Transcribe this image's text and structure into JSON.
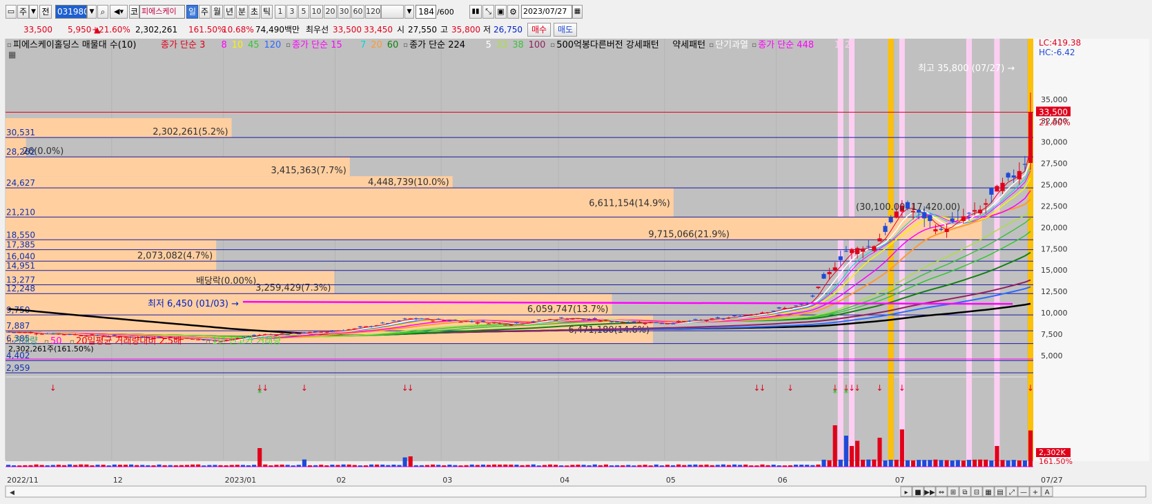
{
  "toolbar": {
    "period_select": "주",
    "adj_select": "전",
    "stock_code": "031980",
    "market_tag": "코",
    "stock_name": "피에스케이",
    "periods": [
      "일",
      "주",
      "월",
      "년",
      "분",
      "초",
      "틱"
    ],
    "active_period": "일",
    "minute_options": [
      "1",
      "3",
      "5",
      "10",
      "20",
      "30",
      "60",
      "120"
    ],
    "count": "184",
    "count_total": "/600",
    "date": "2023/07/27"
  },
  "quote": {
    "price": "33,500",
    "change": "5,950 ▲",
    "change_pct": "+21.60%",
    "volume": "2,302,261",
    "vol_ratio": "161.50%",
    "turnover": "10.68%",
    "amount": "74,490백만",
    "ask_label": "최우선",
    "ask_price": "33,500",
    "bid_price": "33,450",
    "open_label": "시",
    "open": "27,550",
    "high_label": "고",
    "high": "35,800",
    "low_label": "저",
    "low": "26,750",
    "buy_label": "매수",
    "sell_label": "매도"
  },
  "colors": {
    "up": "#e0001a",
    "down": "#1f49d8",
    "panel": "#c0c0c0",
    "vp": "#ffcfa0",
    "bg": "#f0f0f0"
  },
  "chart_data": [
    {
      "type": "candlestick",
      "legend": [
        {
          "text": "피에스케이홀딩스 매물대 수(10)",
          "color": "#000000"
        },
        {
          "text": "종가 단순 3",
          "color": "#e0001a"
        },
        {
          "text": "8",
          "color": "#ff00ff"
        },
        {
          "text": "10",
          "color": "#f5f500"
        },
        {
          "text": "45",
          "color": "#30c830"
        },
        {
          "text": "120",
          "color": "#2a6aff"
        },
        {
          "text": "종가 단순 15",
          "color": "#ff00ff"
        },
        {
          "text": "7",
          "color": "#00d8d8"
        },
        {
          "text": "20",
          "color": "#ff9a30"
        },
        {
          "text": "60",
          "color": "#108010"
        },
        {
          "text": "종가 단순 224",
          "color": "#000000"
        },
        {
          "text": "5",
          "color": "#ffffff"
        },
        {
          "text": "33",
          "color": "#a8e040"
        },
        {
          "text": "38",
          "color": "#40c040"
        },
        {
          "text": "100",
          "color": "#902060"
        },
        {
          "text": "500억봉다른버전 강세패턴",
          "color": "#000000"
        },
        {
          "text": "약세패턴",
          "color": "#000000"
        },
        {
          "text": "단기과열",
          "color": "#ffffff"
        },
        {
          "text": "종가 단순 448",
          "color": "#ff00ff"
        },
        {
          "text": "1",
          "color": "#ffd0f0"
        },
        {
          "text": "2",
          "color": "#ffd0f0"
        }
      ],
      "ylim": [
        2800,
        37500
      ],
      "price_ticks": [
        35000,
        32500,
        30000,
        27500,
        25000,
        22500,
        20000,
        17500,
        15000,
        12500,
        10000,
        7500,
        5000
      ],
      "price_tick_labels": [
        "35,000",
        "32,500",
        "30,000",
        "27,500",
        "25,000",
        "22,500",
        "20,000",
        "17,500",
        "15,000",
        "12,500",
        "10,000",
        "7,500",
        "5,000"
      ],
      "x_ticks": [
        {
          "i": 0,
          "label": "2022/11"
        },
        {
          "i": 19,
          "label": "12"
        },
        {
          "i": 39,
          "label": "2023/01"
        },
        {
          "i": 59,
          "label": "02"
        },
        {
          "i": 78,
          "label": "03"
        },
        {
          "i": 99,
          "label": "04"
        },
        {
          "i": 118,
          "label": "05"
        },
        {
          "i": 138,
          "label": "06"
        },
        {
          "i": 159,
          "label": "07"
        },
        {
          "i": 183,
          "label": "07/27"
        }
      ],
      "n_bars": 184,
      "levels": [
        {
          "v": 30531,
          "label": "30,531"
        },
        {
          "v": 28262,
          "label": "28,262"
        },
        {
          "v": 24627,
          "label": "24,627"
        },
        {
          "v": 21210,
          "label": "21,210"
        },
        {
          "v": 18550,
          "label": "18,550"
        },
        {
          "v": 17385,
          "label": "17,385"
        },
        {
          "v": 16040,
          "label": "16,040"
        },
        {
          "v": 14951,
          "label": "14,951"
        },
        {
          "v": 13277,
          "label": "13,277"
        },
        {
          "v": 12248,
          "label": "12,248"
        },
        {
          "v": 9750,
          "label": "9,750"
        },
        {
          "v": 7887,
          "label": "7,887"
        },
        {
          "v": 6385,
          "label": "6,385"
        },
        {
          "v": 4402,
          "label": "4,402"
        },
        {
          "v": 2959,
          "label": "2,959"
        }
      ],
      "red_line": 33500,
      "volume_profile": [
        {
          "lo": 30531,
          "hi": 32800,
          "len": 0.22,
          "label": "2,302,261(5.2%)"
        },
        {
          "lo": 28262,
          "hi": 30531,
          "len": 0.02,
          "label": "26(0.0%)"
        },
        {
          "lo": 26000,
          "hi": 28262,
          "len": 0.335,
          "label": "3,415,363(7.7%)"
        },
        {
          "lo": 24627,
          "hi": 26000,
          "len": 0.435,
          "label": "4,448,739(10.0%)"
        },
        {
          "lo": 21210,
          "hi": 24627,
          "len": 0.65,
          "label": "6,611,154(14.9%)"
        },
        {
          "lo": 18550,
          "hi": 21210,
          "len": 0.95,
          "label": "9,715,066(21.9%)"
        },
        {
          "lo": 14951,
          "hi": 18550,
          "len": 0.205,
          "label": "2,073,082(4.7%)"
        },
        {
          "lo": 12248,
          "hi": 14951,
          "len": 0.32,
          "label": "3,259,429(7.3%)"
        },
        {
          "lo": 9750,
          "hi": 12248,
          "len": 0.59,
          "label": "6,059,747(13.7%)"
        },
        {
          "lo": 6385,
          "hi": 9750,
          "len": 0.63,
          "label": "6,471,180(14.6%)"
        }
      ],
      "annotations": [
        {
          "text": "최고 35,800 (07/27) →",
          "color": "#ffffff"
        },
        {
          "text": "최저 6,450 (01/03) →",
          "color": "#0020c8"
        },
        {
          "text": "배당락(0.00%)",
          "color": "#303030"
        },
        {
          "text": "(30,100.00",
          "color": "#303030"
        },
        {
          "text": "17,420.00)",
          "color": "#303030"
        },
        {
          "text": "LC:419.38",
          "color": "#e0001a"
        },
        {
          "text": "HC:-6.42",
          "color": "#1f49d8"
        },
        {
          "text": "33,500",
          "color": "#ffffff"
        },
        {
          "text": "21.60%",
          "color": "#e0001a"
        }
      ],
      "close_anchor": [
        {
          "i": 0,
          "c": 7750
        },
        {
          "i": 10,
          "c": 7500
        },
        {
          "i": 20,
          "c": 7200
        },
        {
          "i": 30,
          "c": 7050
        },
        {
          "i": 38,
          "c": 6700
        },
        {
          "i": 45,
          "c": 7400
        },
        {
          "i": 55,
          "c": 7700
        },
        {
          "i": 62,
          "c": 8100
        },
        {
          "i": 72,
          "c": 9300
        },
        {
          "i": 80,
          "c": 9100
        },
        {
          "i": 90,
          "c": 8700
        },
        {
          "i": 100,
          "c": 9400
        },
        {
          "i": 108,
          "c": 9000
        },
        {
          "i": 118,
          "c": 8800
        },
        {
          "i": 128,
          "c": 9300
        },
        {
          "i": 138,
          "c": 10400
        },
        {
          "i": 143,
          "c": 11000
        },
        {
          "i": 146,
          "c": 13800
        },
        {
          "i": 150,
          "c": 17200
        },
        {
          "i": 155,
          "c": 17900
        },
        {
          "i": 158,
          "c": 20500
        },
        {
          "i": 160,
          "c": 22600
        },
        {
          "i": 164,
          "c": 21200
        },
        {
          "i": 167,
          "c": 19500
        },
        {
          "i": 170,
          "c": 21000
        },
        {
          "i": 174,
          "c": 22000
        },
        {
          "i": 177,
          "c": 24500
        },
        {
          "i": 180,
          "c": 26000
        },
        {
          "i": 182,
          "c": 27550
        },
        {
          "i": 183,
          "c": 33500
        }
      ],
      "last_bar": {
        "open": 27550,
        "high": 35800,
        "low": 26750,
        "close": 33500
      },
      "highlights": [
        {
          "i": 149,
          "color": "#ffd0f4"
        },
        {
          "i": 151,
          "color": "#ffd0f4"
        },
        {
          "i": 158,
          "color": "#ffc000"
        },
        {
          "i": 160,
          "color": "#ffd0f4"
        },
        {
          "i": 172,
          "color": "#ffd0f4"
        },
        {
          "i": 177,
          "color": "#ffd0f4"
        },
        {
          "i": 183,
          "color": "#ffc000"
        }
      ]
    },
    {
      "type": "bar",
      "legend": [
        {
          "text": "거래량",
          "color": "#20a0a0"
        },
        {
          "text": "50",
          "color": "#ff00ff"
        },
        {
          "text": "20일평균 거래량대비 2.5배",
          "color": "#e0001a"
        },
        {
          "text": "1년 신고가 거래량",
          "color": "#40e040"
        }
      ],
      "volume_label": "2,302,261주(161.50%)",
      "last_volume_tag": "2,302K",
      "last_volume_pct": "161.50%",
      "arrows": [
        8,
        45,
        46,
        53,
        71,
        72,
        134,
        135,
        140,
        148,
        150,
        151,
        152,
        156,
        160,
        183
      ],
      "stars": [
        45,
        148,
        150
      ],
      "spikes": [
        {
          "i": 45,
          "v": 0.18
        },
        {
          "i": 53,
          "v": 0.07
        },
        {
          "i": 71,
          "v": 0.09
        },
        {
          "i": 72,
          "v": 0.1
        },
        {
          "i": 148,
          "v": 0.4
        },
        {
          "i": 150,
          "v": 0.3
        },
        {
          "i": 151,
          "v": 0.2
        },
        {
          "i": 152,
          "v": 0.25
        },
        {
          "i": 156,
          "v": 0.28
        },
        {
          "i": 160,
          "v": 0.36
        },
        {
          "i": 177,
          "v": 0.2
        },
        {
          "i": 183,
          "v": 0.35
        }
      ]
    }
  ]
}
